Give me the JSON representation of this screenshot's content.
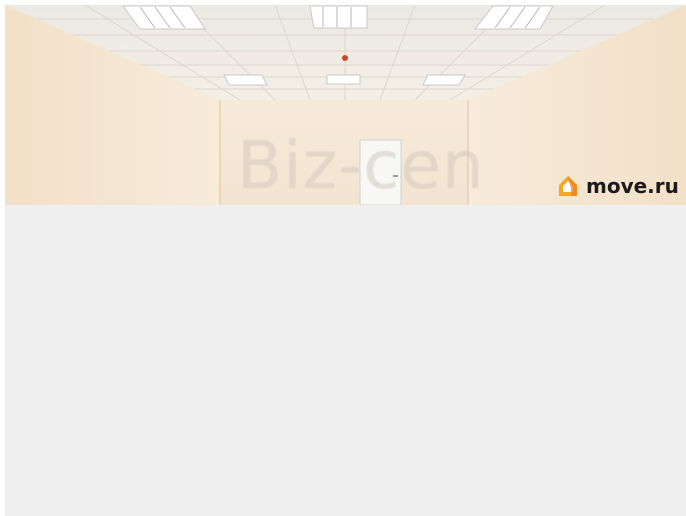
{
  "photo": {
    "watermark_text": "Biz-cen",
    "description_icon": "room-photo"
  },
  "logo": {
    "text": "move.ru",
    "icon": "house-logo-icon",
    "accent_color": "#f5a623"
  },
  "colors": {
    "panel_background": "#efefef",
    "wall": "#f3e6d6"
  }
}
